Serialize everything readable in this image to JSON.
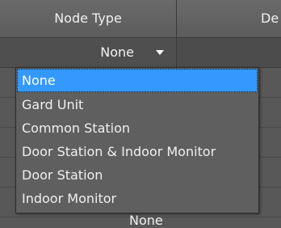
{
  "table": {
    "columns": [
      "Node Type",
      "De"
    ]
  },
  "row": {
    "node_type_value": "None"
  },
  "dropdown": {
    "options": [
      "None",
      "Gard Unit",
      "Common Station",
      "Door Station & Indoor Monitor",
      "Door Station",
      "Indoor Monitor"
    ],
    "selected": "None"
  },
  "below_row_value": "None",
  "colors": {
    "selection": "#3399ff",
    "background": "#5a5a5a"
  },
  "icons": {
    "dropdown_arrow": "chevron-down-icon"
  }
}
